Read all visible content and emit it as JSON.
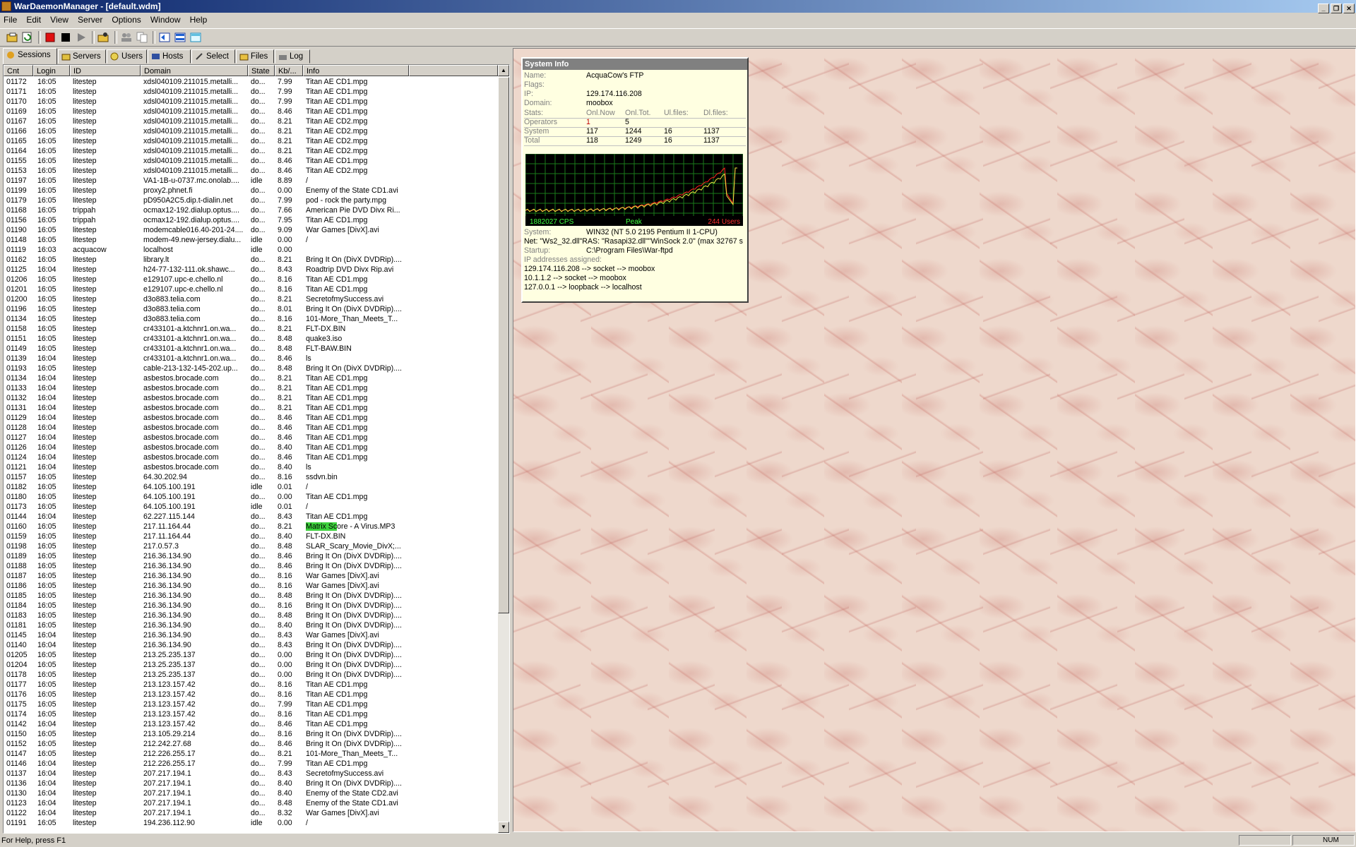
{
  "window": {
    "title": "WarDaemonManager - [default.wdm]"
  },
  "menu": [
    "File",
    "Edit",
    "View",
    "Server",
    "Options",
    "Window",
    "Help"
  ],
  "tabs": [
    "Sessions",
    "Servers",
    "Users",
    "Hosts",
    "Select",
    "Files",
    "Log"
  ],
  "columns": [
    "Cnt",
    "Login",
    "ID",
    "Domain",
    "State",
    "Kb/...",
    "Info"
  ],
  "rows": [
    [
      "01172",
      "16:05",
      "litestep",
      "xdsl040109.211015.metalli...",
      "do...",
      "7.99",
      "Titan AE CD1.mpg"
    ],
    [
      "01171",
      "16:05",
      "litestep",
      "xdsl040109.211015.metalli...",
      "do...",
      "7.99",
      "Titan AE CD1.mpg"
    ],
    [
      "01170",
      "16:05",
      "litestep",
      "xdsl040109.211015.metalli...",
      "do...",
      "7.99",
      "Titan AE CD1.mpg"
    ],
    [
      "01169",
      "16:05",
      "litestep",
      "xdsl040109.211015.metalli...",
      "do...",
      "8.46",
      "Titan AE CD1.mpg"
    ],
    [
      "01167",
      "16:05",
      "litestep",
      "xdsl040109.211015.metalli...",
      "do...",
      "8.21",
      "Titan AE CD2.mpg"
    ],
    [
      "01166",
      "16:05",
      "litestep",
      "xdsl040109.211015.metalli...",
      "do...",
      "8.21",
      "Titan AE CD2.mpg"
    ],
    [
      "01165",
      "16:05",
      "litestep",
      "xdsl040109.211015.metalli...",
      "do...",
      "8.21",
      "Titan AE CD2.mpg"
    ],
    [
      "01164",
      "16:05",
      "litestep",
      "xdsl040109.211015.metalli...",
      "do...",
      "8.21",
      "Titan AE CD2.mpg"
    ],
    [
      "01155",
      "16:05",
      "litestep",
      "xdsl040109.211015.metalli...",
      "do...",
      "8.46",
      "Titan AE CD1.mpg"
    ],
    [
      "01153",
      "16:05",
      "litestep",
      "xdsl040109.211015.metalli...",
      "do...",
      "8.46",
      "Titan AE CD2.mpg"
    ],
    [
      "01197",
      "16:05",
      "litestep",
      "VA1-1B-u-0737.mc.onolab....",
      "idle",
      "8.89",
      "/"
    ],
    [
      "01199",
      "16:05",
      "litestep",
      "proxy2.phnet.fi",
      "do...",
      "0.00",
      "Enemy of the State CD1.avi"
    ],
    [
      "01179",
      "16:05",
      "litestep",
      "pD950A2C5.dip.t-dialin.net",
      "do...",
      "7.99",
      "pod - rock the party.mpg"
    ],
    [
      "01168",
      "16:05",
      "trippah",
      "ocmax12-192.dialup.optus....",
      "do...",
      "7.66",
      "American Pie DVD Divx Ri..."
    ],
    [
      "01156",
      "16:05",
      "trippah",
      "ocmax12-192.dialup.optus....",
      "do...",
      "7.95",
      "Titan AE CD1.mpg"
    ],
    [
      "01190",
      "16:05",
      "litestep",
      "modemcable016.40-201-24....",
      "do...",
      "9.09",
      "War Games [DivX].avi"
    ],
    [
      "01148",
      "16:05",
      "litestep",
      "modem-49.new-jersey.dialu...",
      "idle",
      "0.00",
      "/"
    ],
    [
      "01119",
      "16:03",
      "acquacow",
      "localhost",
      "idle",
      "0.00",
      ""
    ],
    [
      "01162",
      "16:05",
      "litestep",
      "library.lt",
      "do...",
      "8.21",
      "Bring It On (DivX DVDRip)...."
    ],
    [
      "01125",
      "16:04",
      "litestep",
      "h24-77-132-111.ok.shawc...",
      "do...",
      "8.43",
      "Roadtrip DVD Divx Rip.avi"
    ],
    [
      "01206",
      "16:05",
      "litestep",
      "e129107.upc-e.chello.nl",
      "do...",
      "8.16",
      "Titan AE CD1.mpg"
    ],
    [
      "01201",
      "16:05",
      "litestep",
      "e129107.upc-e.chello.nl",
      "do...",
      "8.16",
      "Titan AE CD1.mpg"
    ],
    [
      "01200",
      "16:05",
      "litestep",
      "d3o883.telia.com",
      "do...",
      "8.21",
      "SecretofmySuccess.avi"
    ],
    [
      "01196",
      "16:05",
      "litestep",
      "d3o883.telia.com",
      "do...",
      "8.01",
      "Bring It On (DivX DVDRip)...."
    ],
    [
      "01134",
      "16:05",
      "litestep",
      "d3o883.telia.com",
      "do...",
      "8.16",
      "101-More_Than_Meets_T..."
    ],
    [
      "01158",
      "16:05",
      "litestep",
      "cr433101-a.ktchnr1.on.wa...",
      "do...",
      "8.21",
      "FLT-DX.BIN"
    ],
    [
      "01151",
      "16:05",
      "litestep",
      "cr433101-a.ktchnr1.on.wa...",
      "do...",
      "8.48",
      "quake3.iso"
    ],
    [
      "01149",
      "16:05",
      "litestep",
      "cr433101-a.ktchnr1.on.wa...",
      "do...",
      "8.48",
      "FLT-BAW.BIN"
    ],
    [
      "01139",
      "16:04",
      "litestep",
      "cr433101-a.ktchnr1.on.wa...",
      "do...",
      "8.46",
      "ls"
    ],
    [
      "01193",
      "16:05",
      "litestep",
      "cable-213-132-145-202.up...",
      "do...",
      "8.48",
      "Bring It On (DivX DVDRip)...."
    ],
    [
      "01134",
      "16:04",
      "litestep",
      "asbestos.brocade.com",
      "do...",
      "8.21",
      "Titan AE CD1.mpg"
    ],
    [
      "01133",
      "16:04",
      "litestep",
      "asbestos.brocade.com",
      "do...",
      "8.21",
      "Titan AE CD1.mpg"
    ],
    [
      "01132",
      "16:04",
      "litestep",
      "asbestos.brocade.com",
      "do...",
      "8.21",
      "Titan AE CD1.mpg"
    ],
    [
      "01131",
      "16:04",
      "litestep",
      "asbestos.brocade.com",
      "do...",
      "8.21",
      "Titan AE CD1.mpg"
    ],
    [
      "01129",
      "16:04",
      "litestep",
      "asbestos.brocade.com",
      "do...",
      "8.46",
      "Titan AE CD1.mpg"
    ],
    [
      "01128",
      "16:04",
      "litestep",
      "asbestos.brocade.com",
      "do...",
      "8.46",
      "Titan AE CD1.mpg"
    ],
    [
      "01127",
      "16:04",
      "litestep",
      "asbestos.brocade.com",
      "do...",
      "8.46",
      "Titan AE CD1.mpg"
    ],
    [
      "01126",
      "16:04",
      "litestep",
      "asbestos.brocade.com",
      "do...",
      "8.40",
      "Titan AE CD1.mpg"
    ],
    [
      "01124",
      "16:04",
      "litestep",
      "asbestos.brocade.com",
      "do...",
      "8.46",
      "Titan AE CD1.mpg"
    ],
    [
      "01121",
      "16:04",
      "litestep",
      "asbestos.brocade.com",
      "do...",
      "8.40",
      "ls"
    ],
    [
      "01157",
      "16:05",
      "litestep",
      "64.30.202.94",
      "do...",
      "8.16",
      "ssdvn.bin"
    ],
    [
      "01182",
      "16:05",
      "litestep",
      "64.105.100.191",
      "idle",
      "0.01",
      "/"
    ],
    [
      "01180",
      "16:05",
      "litestep",
      "64.105.100.191",
      "do...",
      "0.00",
      "Titan AE CD1.mpg"
    ],
    [
      "01173",
      "16:05",
      "litestep",
      "64.105.100.191",
      "idle",
      "0.01",
      "/"
    ],
    [
      "01144",
      "16:04",
      "litestep",
      "62.227.115.144",
      "do...",
      "8.43",
      "Titan AE CD1.mpg"
    ],
    [
      "01160",
      "16:05",
      "litestep",
      "217.11.164.44",
      "do...",
      "8.21",
      "Matrix Score - A Virus.MP3"
    ],
    [
      "01159",
      "16:05",
      "litestep",
      "217.11.164.44",
      "do...",
      "8.40",
      "FLT-DX.BIN"
    ],
    [
      "01198",
      "16:05",
      "litestep",
      "217.0.57.3",
      "do...",
      "8.48",
      "SLAR_Scary_Movie_DivX;..."
    ],
    [
      "01189",
      "16:05",
      "litestep",
      "216.36.134.90",
      "do...",
      "8.46",
      "Bring It On (DivX DVDRip)...."
    ],
    [
      "01188",
      "16:05",
      "litestep",
      "216.36.134.90",
      "do...",
      "8.46",
      "Bring It On (DivX DVDRip)...."
    ],
    [
      "01187",
      "16:05",
      "litestep",
      "216.36.134.90",
      "do...",
      "8.16",
      "War Games [DivX].avi"
    ],
    [
      "01186",
      "16:05",
      "litestep",
      "216.36.134.90",
      "do...",
      "8.16",
      "War Games [DivX].avi"
    ],
    [
      "01185",
      "16:05",
      "litestep",
      "216.36.134.90",
      "do...",
      "8.48",
      "Bring It On (DivX DVDRip)...."
    ],
    [
      "01184",
      "16:05",
      "litestep",
      "216.36.134.90",
      "do...",
      "8.16",
      "Bring It On (DivX DVDRip)...."
    ],
    [
      "01183",
      "16:05",
      "litestep",
      "216.36.134.90",
      "do...",
      "8.48",
      "Bring It On (DivX DVDRip)...."
    ],
    [
      "01181",
      "16:05",
      "litestep",
      "216.36.134.90",
      "do...",
      "8.40",
      "Bring It On (DivX DVDRip)...."
    ],
    [
      "01145",
      "16:04",
      "litestep",
      "216.36.134.90",
      "do...",
      "8.43",
      "War Games [DivX].avi"
    ],
    [
      "01140",
      "16:04",
      "litestep",
      "216.36.134.90",
      "do...",
      "8.43",
      "Bring It On (DivX DVDRip)...."
    ],
    [
      "01205",
      "16:05",
      "litestep",
      "213.25.235.137",
      "do...",
      "0.00",
      "Bring It On (DivX DVDRip)...."
    ],
    [
      "01204",
      "16:05",
      "litestep",
      "213.25.235.137",
      "do...",
      "0.00",
      "Bring It On (DivX DVDRip)...."
    ],
    [
      "01178",
      "16:05",
      "litestep",
      "213.25.235.137",
      "do...",
      "0.00",
      "Bring It On (DivX DVDRip)...."
    ],
    [
      "01177",
      "16:05",
      "litestep",
      "213.123.157.42",
      "do...",
      "8.16",
      "Titan AE CD1.mpg"
    ],
    [
      "01176",
      "16:05",
      "litestep",
      "213.123.157.42",
      "do...",
      "8.16",
      "Titan AE CD1.mpg"
    ],
    [
      "01175",
      "16:05",
      "litestep",
      "213.123.157.42",
      "do...",
      "7.99",
      "Titan AE CD1.mpg"
    ],
    [
      "01174",
      "16:05",
      "litestep",
      "213.123.157.42",
      "do...",
      "8.16",
      "Titan AE CD1.mpg"
    ],
    [
      "01142",
      "16:04",
      "litestep",
      "213.123.157.42",
      "do...",
      "8.46",
      "Titan AE CD1.mpg"
    ],
    [
      "01150",
      "16:05",
      "litestep",
      "213.105.29.214",
      "do...",
      "8.16",
      "Bring It On (DivX DVDRip)...."
    ],
    [
      "01152",
      "16:05",
      "litestep",
      "212.242.27.68",
      "do...",
      "8.46",
      "Bring It On (DivX DVDRip)...."
    ],
    [
      "01147",
      "16:05",
      "litestep",
      "212.226.255.17",
      "do...",
      "8.21",
      "101-More_Than_Meets_T..."
    ],
    [
      "01146",
      "16:04",
      "litestep",
      "212.226.255.17",
      "do...",
      "7.99",
      "Titan AE CD1.mpg"
    ],
    [
      "01137",
      "16:04",
      "litestep",
      "207.217.194.1",
      "do...",
      "8.43",
      "SecretofmySuccess.avi"
    ],
    [
      "01136",
      "16:04",
      "litestep",
      "207.217.194.1",
      "do...",
      "8.40",
      "Bring It On (DivX DVDRip)...."
    ],
    [
      "01130",
      "16:04",
      "litestep",
      "207.217.194.1",
      "do...",
      "8.40",
      "Enemy of the State CD2.avi"
    ],
    [
      "01123",
      "16:04",
      "litestep",
      "207.217.194.1",
      "do...",
      "8.48",
      "Enemy of the State CD1.avi"
    ],
    [
      "01122",
      "16:04",
      "litestep",
      "207.217.194.1",
      "do...",
      "8.32",
      "War Games [DivX].avi"
    ],
    [
      "01191",
      "16:05",
      "litestep",
      "194.236.112.90",
      "idle",
      "0.00",
      "/"
    ]
  ],
  "highlight": {
    "row_cnt": "01160",
    "color": "#3cd23c",
    "text": "Matrix Sc"
  },
  "sysinfo": {
    "caption": "System Info",
    "name_label": "Name:",
    "name": "AcquaCow's FTP",
    "flags_label": "Flags:",
    "ip_label": "IP:",
    "ip": "129.174.116.208",
    "domain_label": "Domain:",
    "domain": "moobox",
    "stats_header": [
      "Stats:",
      "Onl.Now",
      "Onl.Tot.",
      "Ul.files:",
      "Dl.files:"
    ],
    "stats": [
      [
        "Operators",
        "1",
        "5",
        "",
        ""
      ],
      [
        "System",
        "117",
        "1244",
        "16",
        "1137"
      ],
      [
        "Total",
        "118",
        "1249",
        "16",
        "1137"
      ]
    ],
    "graph": {
      "left_label": "1882027 CPS",
      "mid_label": "Peak",
      "right_label": "244 Users"
    },
    "system_label": "System:",
    "system": "WIN32 (NT 5.0 2195 Pentium II 1-CPU)",
    "net_line": "Net: \"Ws2_32.dll\"RAS: \"Rasapi32.dll\"\"WinSock 2.0\" (max 32767 s",
    "startup_label": "Startup:",
    "startup": "C:\\Program Files\\War-ftpd",
    "ip_assigned_label": "IP addresses assigned:",
    "ip_lines": [
      "129.174.116.208 --> socket --> moobox",
      "10.1.1.2 --> socket --> moobox",
      "127.0.0.1 --> loopback --> localhost"
    ]
  },
  "status": {
    "help": "For Help, press F1",
    "num": "NUM"
  },
  "colors": {
    "title_start": "#0a246a",
    "title_end": "#a6caf0",
    "graph_green": "#1a7a1a",
    "graph_red": "#ff2020",
    "graph_yellow": "#e8e840"
  }
}
